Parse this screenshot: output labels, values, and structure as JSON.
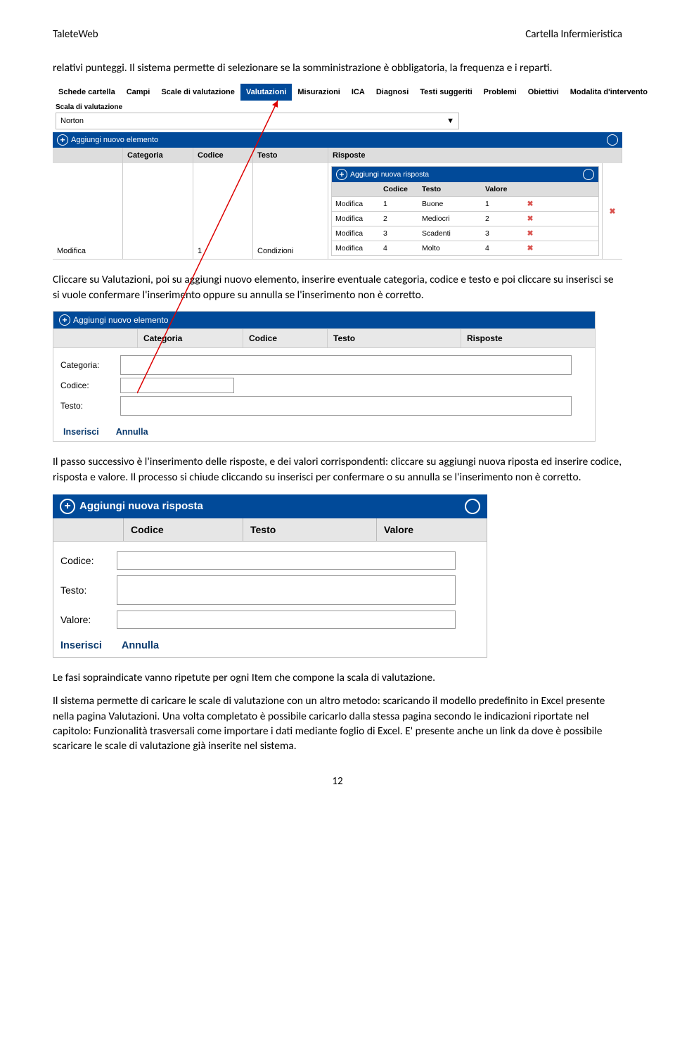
{
  "header": {
    "left": "TaleteWeb",
    "right": "Cartella Infermieristica"
  },
  "p_intro": "relativi punteggi. Il sistema permette di selezionare se la somministrazione è obbligatoria, la frequenza e i reparti.",
  "shot1": {
    "tabs": [
      "Schede cartella",
      "Campi",
      "Scale di valutazione",
      "Valutazioni",
      "Misurazioni",
      "ICA",
      "Diagnosi",
      "Testi suggeriti",
      "Problemi",
      "Obiettivi",
      "Modalita d'intervento"
    ],
    "active_tab_index": 3,
    "scala_label": "Scala di valutazione",
    "scala_value": "Norton",
    "dropdown_caret": "▼",
    "add_elem": "Aggiungi nuovo elemento",
    "cols": {
      "categoria": "Categoria",
      "codice": "Codice",
      "testo": "Testo",
      "risposte": "Risposte"
    },
    "row": {
      "modifica": "Modifica",
      "num": "1",
      "cond": "Condizioni"
    },
    "inner": {
      "add": "Aggiungi nuova risposta",
      "cols": {
        "mod": "",
        "cod": "Codice",
        "testo": "Testo",
        "val": "Valore"
      },
      "rows": [
        {
          "mod": "Modifica",
          "cod": "1",
          "testo": "Buone",
          "val": "1"
        },
        {
          "mod": "Modifica",
          "cod": "2",
          "testo": "Mediocri",
          "val": "2"
        },
        {
          "mod": "Modifica",
          "cod": "3",
          "testo": "Scadenti",
          "val": "3"
        },
        {
          "mod": "Modifica",
          "cod": "4",
          "testo": "Molto",
          "val": "4"
        }
      ]
    }
  },
  "p_mid": "Cliccare su Valutazioni, poi su aggiungi nuovo elemento, inserire eventuale categoria, codice e testo e poi cliccare su inserisci se si vuole confermare l'inserimento oppure su annulla se l'inserimento non è corretto.",
  "shot2": {
    "add": "Aggiungi nuovo elemento",
    "cols": {
      "categoria": "Categoria",
      "codice": "Codice",
      "testo": "Testo",
      "risposte": "Risposte"
    },
    "labels": {
      "categoria": "Categoria:",
      "codice": "Codice:",
      "testo": "Testo:"
    },
    "actions": {
      "ins": "Inserisci",
      "ann": "Annulla"
    }
  },
  "p_after2": "Il passo successivo è l'inserimento delle risposte, e dei valori corrispondenti: cliccare su aggiungi nuova riposta ed inserire codice, risposta e valore. Il processo si chiude cliccando su inserisci per confermare o su annulla se l'inserimento non è corretto.",
  "shot3": {
    "add": "Aggiungi nuova risposta",
    "cols": {
      "codice": "Codice",
      "testo": "Testo",
      "valore": "Valore"
    },
    "labels": {
      "codice": "Codice:",
      "testo": "Testo:",
      "valore": "Valore:"
    },
    "actions": {
      "ins": "Inserisci",
      "ann": "Annulla"
    }
  },
  "p_end1": "Le fasi sopraindicate vanno ripetute per ogni Item che compone la scala di valutazione.",
  "p_end2": "Il sistema permette di caricare le scale di valutazione con un altro metodo: scaricando il modello predefinito in Excel presente nella pagina Valutazioni. Una volta completato è possibile caricarlo dalla stessa pagina secondo le indicazioni riportate nel capitolo: Funzionalità trasversali come importare i dati mediante foglio di Excel. E' presente anche un link da dove è possibile scaricare le scale di valutazione già inserite nel sistema.",
  "page_number": "12"
}
